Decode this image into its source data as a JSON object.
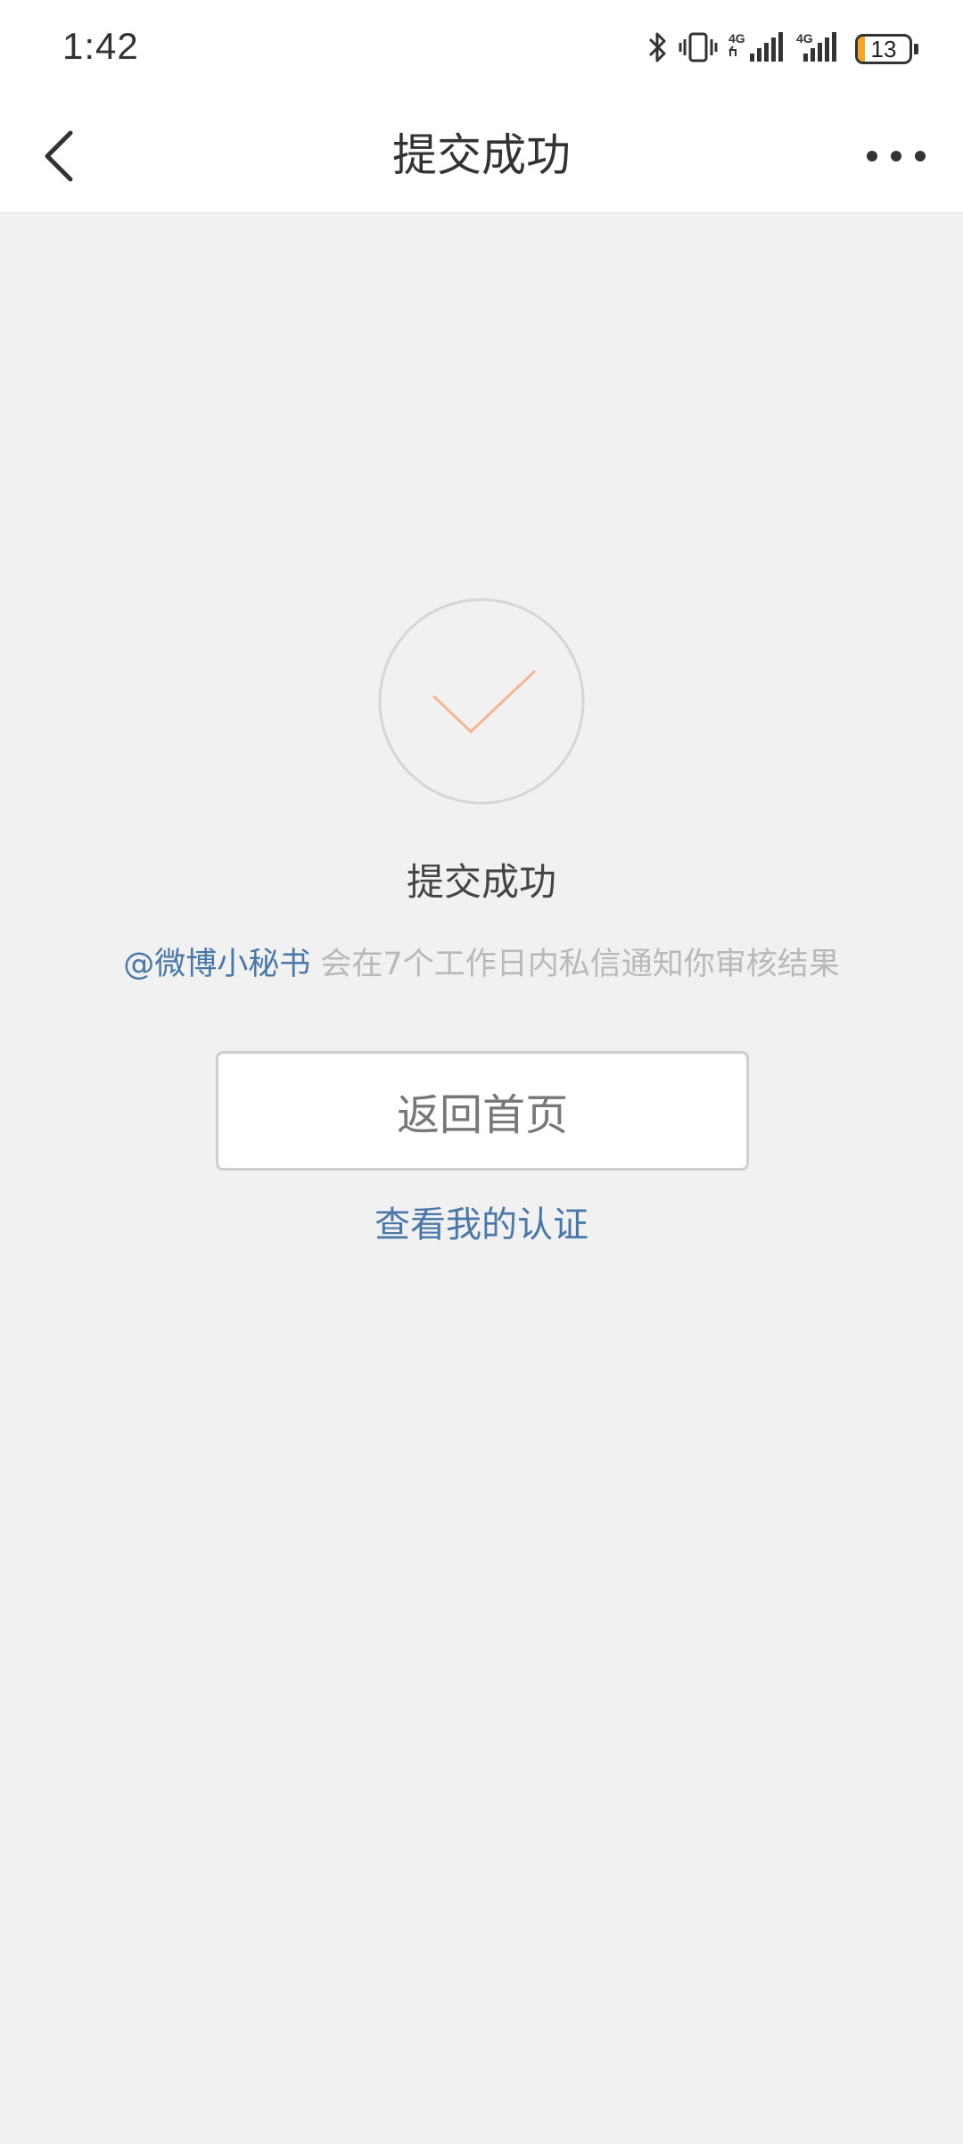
{
  "status_bar": {
    "time": "1:42",
    "icons": [
      "bluetooth-icon",
      "vibrate-icon",
      "signal-4g-icon",
      "signal-4g-icon"
    ],
    "signal_label": "4G",
    "battery_level": "13",
    "battery_percent": 13,
    "battery_color": "#f5a623"
  },
  "nav": {
    "title": "提交成功",
    "back_icon": "chevron-left-icon",
    "more_icon": "more-icon"
  },
  "result": {
    "icon": "checkmark-icon",
    "check_color": "#f5b78f",
    "title": "提交成功",
    "notice_link": "@微博小秘书",
    "notice_text": " 会在7个工作日内私信通知你审核结果"
  },
  "actions": {
    "home_button_label": "返回首页",
    "view_cert_label": "查看我的认证"
  },
  "colors": {
    "link": "#4a78a8",
    "background": "#f1f1f1"
  }
}
